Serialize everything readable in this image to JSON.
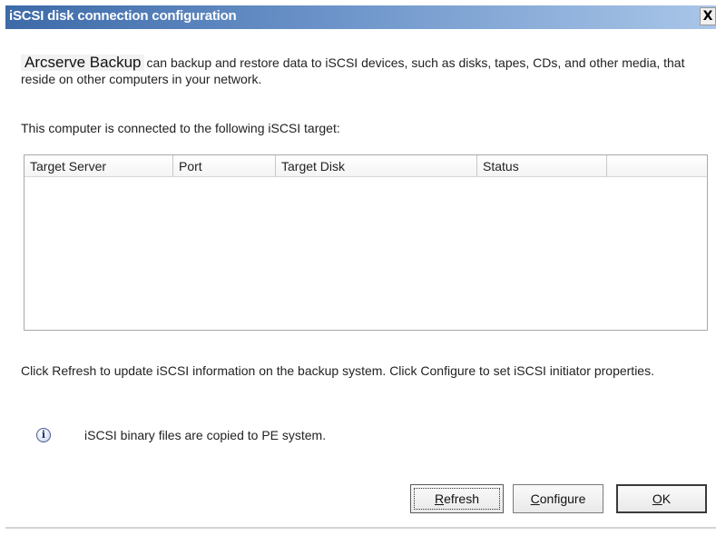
{
  "window": {
    "title": "iSCSI disk connection configuration",
    "close_label": "X"
  },
  "intro": {
    "brand": "Arcserve Backup",
    "text": "can backup and restore data to iSCSI devices, such as disks, tapes, CDs, and other media, that reside on other computers in your network."
  },
  "target_label": "This computer is connected to the following iSCSI target:",
  "table": {
    "columns": [
      "Target Server",
      "Port",
      "Target Disk",
      "Status",
      ""
    ],
    "rows": []
  },
  "refresh_hint": "Click Refresh to update iSCSI information on the backup system. Click Configure to set iSCSI initiator properties.",
  "info": {
    "icon": "info-icon",
    "glyph": "i",
    "text": "iSCSI binary files are copied to PE system."
  },
  "buttons": {
    "refresh": {
      "accel": "R",
      "rest": "efresh"
    },
    "configure": {
      "accel": "C",
      "rest": "onfigure"
    },
    "ok": {
      "accel": "O",
      "rest": "K"
    }
  },
  "colors": {
    "title_bar_start": "#3d6aa8",
    "title_bar_end": "#a9c6e8"
  }
}
